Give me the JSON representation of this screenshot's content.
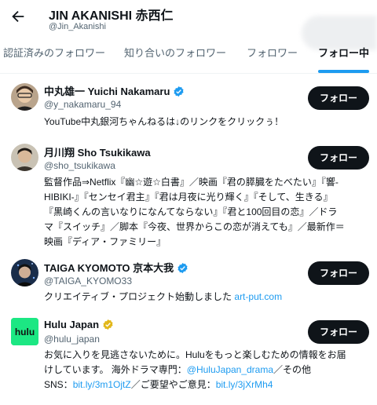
{
  "header": {
    "name": "JIN AKANISHI 赤西仁",
    "handle": "@Jin_Akanishi"
  },
  "tabs": [
    {
      "label": "認証済みのフォロワー",
      "active": false
    },
    {
      "label": "知り合いのフォロワー",
      "active": false
    },
    {
      "label": "フォロワー",
      "active": false
    },
    {
      "label": "フォロー中",
      "active": true
    }
  ],
  "colors": {
    "accent": "#1d9bf0",
    "verified_gold": "#e2b719",
    "hulu": "#1ce783",
    "text": "#0f1419",
    "muted": "#536471"
  },
  "users": [
    {
      "name": "中丸雄一 Yuichi Nakamaru",
      "handle": "@y_nakamaru_94",
      "verified": "blue",
      "button": "フォロー",
      "bio": "YouTube中丸銀河ちゃんねるは↓のリンクをクリックぅ！"
    },
    {
      "name": "月川翔 Sho Tsukikawa",
      "handle": "@sho_tsukikawa",
      "verified": "none",
      "button": "フォロー",
      "bio_lines": [
        "監督作品⇒Netflix『幽☆遊☆白書』／映画『君の膵臓をたべたい』『響-",
        "HIBIKI-』『センセイ君主』『君は月夜に光り輝く』『そして、生きる』",
        "『黒崎くんの言いなりになんてならない』『君と100回目の恋』／ドラ",
        "マ『スイッチ』／脚本『今夜、世界からこの恋が消えても』／最新作＝",
        "映画『ディア・ファミリー』"
      ]
    },
    {
      "name": "TAIGA KYOMOTO 京本大我",
      "handle": "@TAIGA_KYOMO33",
      "verified": "blue",
      "button": "フォロー",
      "bio": "クリエイティブ・プロジェクト始動しました ",
      "bio_link": "art-put.com"
    },
    {
      "name": "Hulu Japan",
      "handle": "@hulu_japan",
      "verified": "gold",
      "button": "フォロー",
      "avatar_text": "hulu",
      "bio_l1": "お気に入りを見逃さないために。Huluをもっと楽しむための情報をお届",
      "bio_l2a": "けしています。 海外ドラマ専門：",
      "bio_l2link": "@HuluJapan_drama",
      "bio_l2b": "／その他",
      "bio_l3a": "SNS：",
      "bio_l3link1": "bit.ly/3m1OjtZ",
      "bio_l3b": "／ご要望やご意見：",
      "bio_l3link2": "bit.ly/3jXrMh4"
    }
  ]
}
